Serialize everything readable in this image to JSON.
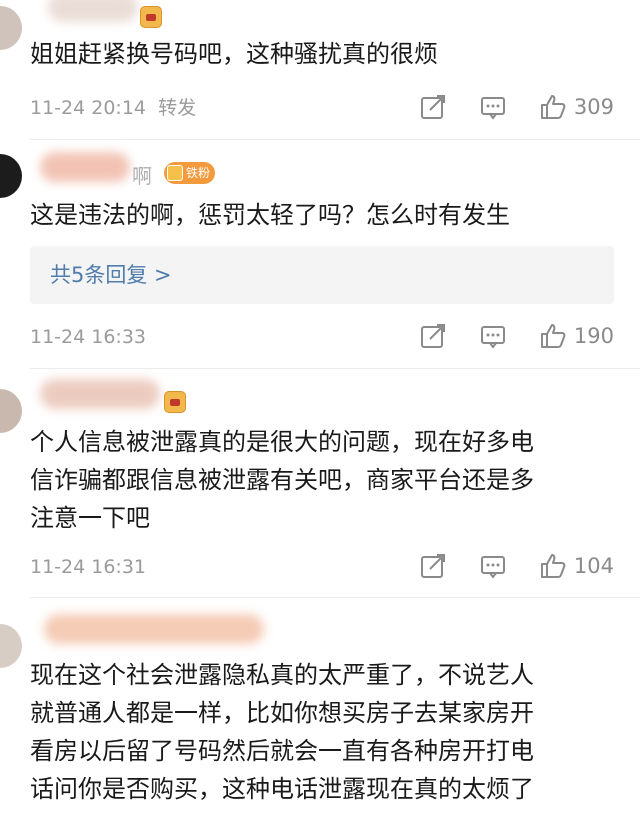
{
  "comments": [
    {
      "text": "姐姐赶紧换号码吧，这种骚扰真的很烦",
      "time": "11-24 20:14",
      "repost_label": "转发",
      "likes": "309"
    },
    {
      "text": "这是违法的啊，惩罚太轻了吗？怎么时有发生",
      "name_suffix": "啊",
      "fan_label": "铁粉",
      "replies_label": "共5条回复 >",
      "time": "11-24 16:33",
      "likes": "190"
    },
    {
      "text": "个人信息被泄露真的是很大的问题，现在好多电\n信诈骗都跟信息被泄露有关吧，商家平台还是多\n注意一下吧",
      "time": "11-24 16:31",
      "likes": "104"
    },
    {
      "text": "现在这个社会泄露隐私真的太严重了，不说艺人\n就普通人都是一样，比如你想买房子去某家房开\n看房以后留了号码然后就会一直有各种房开打电\n话问你是否购买，这种电话泄露现在真的太烦了"
    }
  ],
  "icons": {
    "share": "share-icon",
    "comment": "comment-icon",
    "like": "thumbs-up-icon"
  },
  "colors": {
    "link": "#4f7cab",
    "meta": "#9b9b9b",
    "fan_tag": "#f29a3c"
  }
}
